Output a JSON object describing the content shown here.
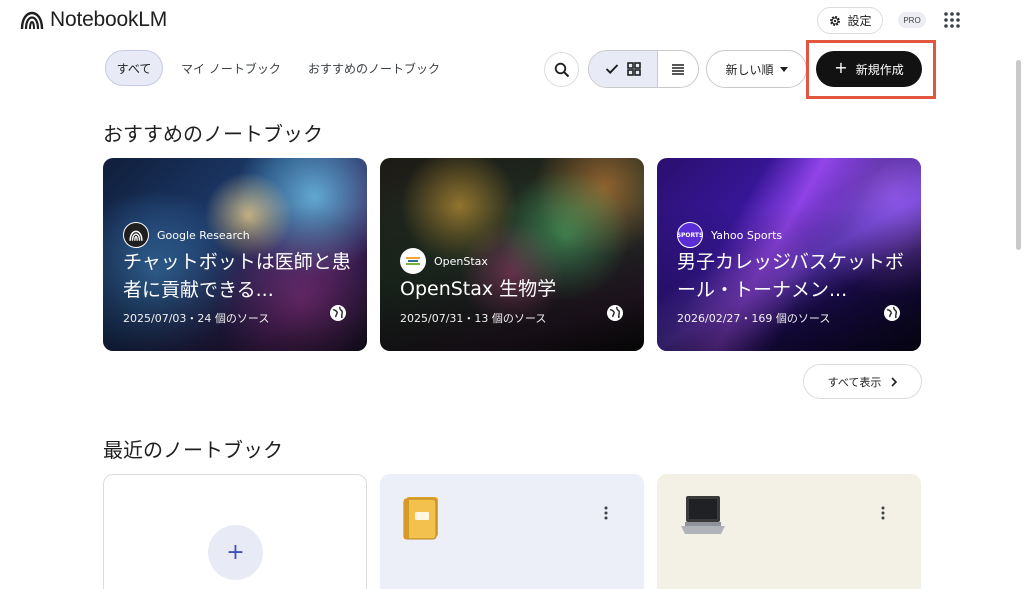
{
  "app": {
    "name": "NotebookLM"
  },
  "header": {
    "settings_label": "設定",
    "pro_badge": "PRO",
    "apps_icon": "apps-grid-icon"
  },
  "toolbar": {
    "tabs": [
      {
        "label": "すべて",
        "active": true
      },
      {
        "label": "マイ ノートブック",
        "active": false
      },
      {
        "label": "おすすめのノートブック",
        "active": false
      }
    ],
    "search_icon": "search-icon",
    "view_mode": "grid",
    "sort_label": "新しい順",
    "new_button_label": "新規作成",
    "highlight_color": "#e2553f"
  },
  "featured": {
    "title": "おすすめのノートブック",
    "cards": [
      {
        "source": "Google Research",
        "title": "チャットボットは医師と患者に貢献できる...",
        "meta": "2025/07/03・24 個のソース",
        "public": true
      },
      {
        "source": "OpenStax",
        "title": "OpenStax 生物学",
        "meta": "2025/07/31・13 個のソース",
        "public": true
      },
      {
        "source": "Yahoo Sports",
        "title": "男子カレッジバスケットボール・トーナメン...",
        "meta": "2026/02/27・169 個のソース",
        "public": true
      }
    ],
    "show_all_label": "すべて表示"
  },
  "recent": {
    "title": "最近のノートブック",
    "cards": [
      {
        "type": "create-new"
      },
      {
        "type": "notebook",
        "emoji": "notebook-emoji"
      },
      {
        "type": "notebook",
        "emoji": "laptop-emoji"
      }
    ]
  },
  "colors": {
    "accent": "#3f51b5",
    "primary_button": "#121212",
    "selected_bg": "#e8eaf6"
  }
}
